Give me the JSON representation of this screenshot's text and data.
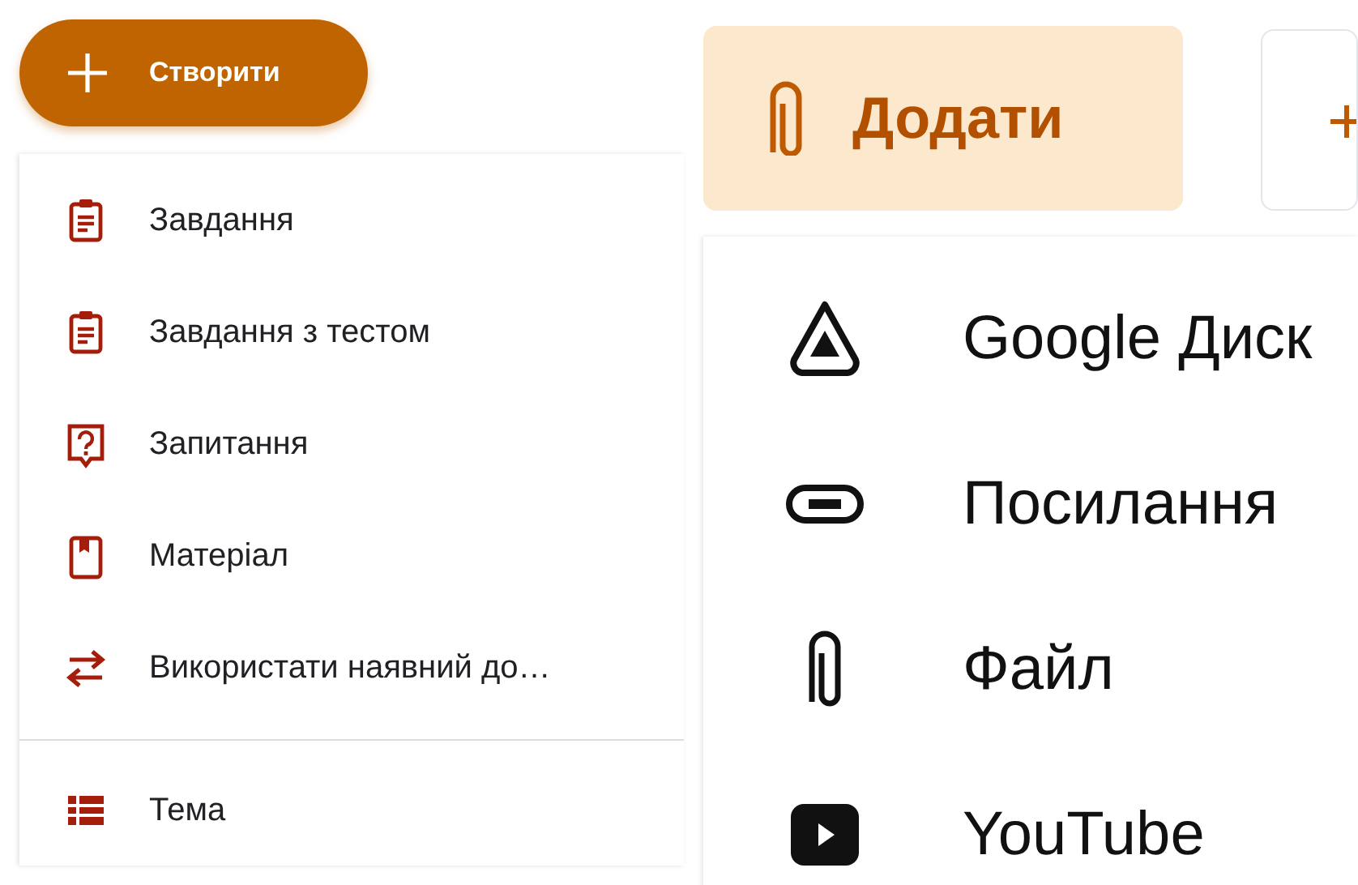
{
  "create_button": {
    "label": "Створити"
  },
  "create_menu": {
    "groups": [
      [
        {
          "kind": "assignment",
          "label": "Завдання"
        },
        {
          "kind": "quiz",
          "label": "Завдання з тестом"
        },
        {
          "kind": "question",
          "label": "Запитання"
        },
        {
          "kind": "material",
          "label": "Матеріал"
        },
        {
          "kind": "reuse",
          "label": "Використати наявний до…"
        }
      ],
      [
        {
          "kind": "topic",
          "label": "Тема"
        }
      ]
    ]
  },
  "add_button": {
    "label": "Додати"
  },
  "add_menu": {
    "items": [
      {
        "kind": "drive",
        "label": "Google Диск"
      },
      {
        "kind": "link",
        "label": "Посилання"
      },
      {
        "kind": "file",
        "label": "Файл"
      },
      {
        "kind": "youtube",
        "label": "YouTube"
      }
    ]
  }
}
